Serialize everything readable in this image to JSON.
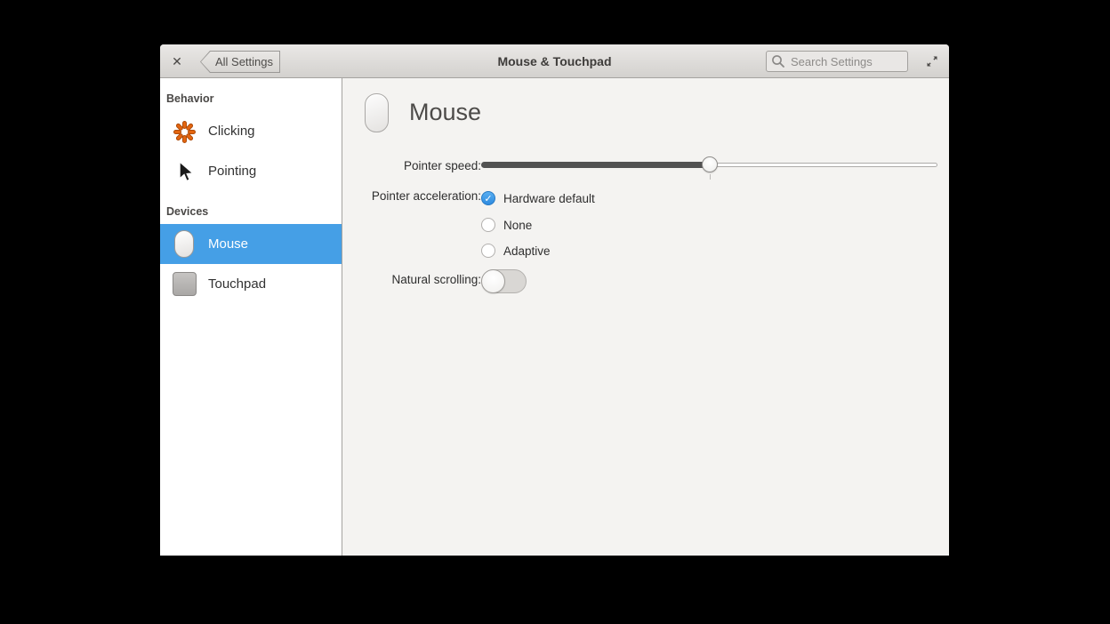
{
  "window": {
    "titlebar": {
      "close_glyph": "✕",
      "back_label": "All Settings",
      "title": "Mouse & Touchpad",
      "search_placeholder": "Search Settings"
    },
    "sidebar": {
      "sections": [
        {
          "header": "Behavior",
          "items": [
            {
              "label": "Clicking",
              "icon": "click-burst-icon"
            },
            {
              "label": "Pointing",
              "icon": "cursor-icon"
            }
          ]
        },
        {
          "header": "Devices",
          "items": [
            {
              "label": "Mouse",
              "icon": "mouse-icon",
              "selected": true
            },
            {
              "label": "Touchpad",
              "icon": "touchpad-icon",
              "selected": false
            }
          ]
        }
      ]
    },
    "content": {
      "page_title": "Mouse",
      "pointer_speed": {
        "label": "Pointer speed:",
        "value_percent": 50
      },
      "pointer_acceleration": {
        "label": "Pointer acceleration:",
        "options": [
          {
            "label": "Hardware default",
            "selected": true
          },
          {
            "label": "None",
            "selected": false
          },
          {
            "label": "Adaptive",
            "selected": false
          }
        ]
      },
      "natural_scrolling": {
        "label": "Natural scrolling:",
        "enabled": false
      }
    },
    "colors": {
      "accent_blue": "#459fe6",
      "burst_orange": "#e4650f",
      "titlebar_top": "#eae8e6",
      "titlebar_bottom": "#d3d1ce",
      "content_bg": "#f4f3f1"
    }
  }
}
